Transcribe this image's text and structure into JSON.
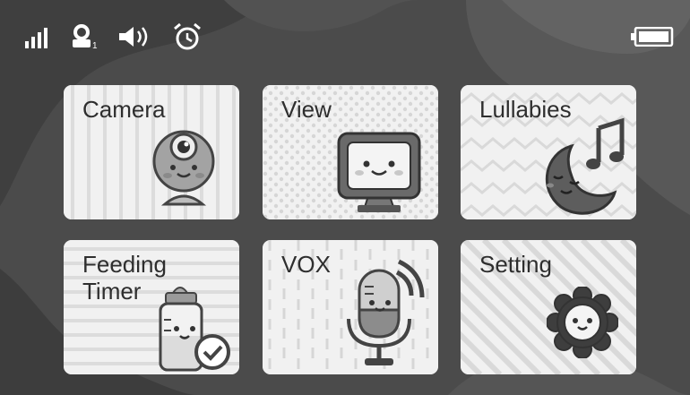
{
  "status": {
    "signal_icon": "signal-bars-icon",
    "camera_user_icon": "camera-user-icon",
    "camera_user_index": "1",
    "volume_icon": "volume-icon",
    "alarm_icon": "alarm-clock-icon",
    "battery_icon": "battery-full-icon"
  },
  "menu": {
    "camera": {
      "label": "Camera",
      "icon": "camera-character-icon"
    },
    "view": {
      "label": "View",
      "icon": "monitor-character-icon"
    },
    "lullabies": {
      "label": "Lullabies",
      "icon": "moon-music-icon"
    },
    "feeding_timer": {
      "line1": "Feeding",
      "line2": "Timer",
      "icon": "baby-bottle-clock-icon"
    },
    "vox": {
      "label": "VOX",
      "icon": "microphone-character-icon"
    },
    "setting": {
      "label": "Setting",
      "icon": "gear-face-icon"
    }
  }
}
